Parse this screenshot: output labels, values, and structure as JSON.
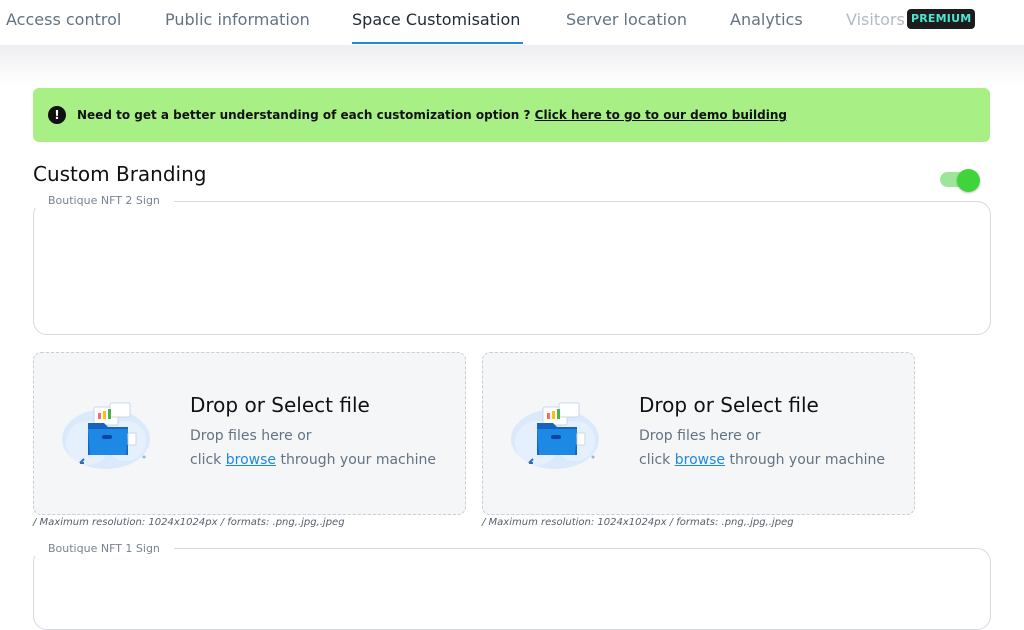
{
  "tabs": [
    {
      "label": "Access control"
    },
    {
      "label": "Public information"
    },
    {
      "label": "Space Customisation"
    },
    {
      "label": "Server location"
    },
    {
      "label": "Analytics"
    },
    {
      "label": "Visitors"
    }
  ],
  "badge": {
    "label": "PREMIUM"
  },
  "alert": {
    "text": "Need to get a better understanding of each customization option ?",
    "link": "Click here to go to our demo building"
  },
  "branding": {
    "title": "Custom Branding",
    "toggle_on": true,
    "sign2_label": "Boutique NFT 2 Sign",
    "sign1_label": "Boutique NFT 1 Sign"
  },
  "dropzones": [
    {
      "title": "Drop or Select file",
      "line1": "Drop files here or",
      "line2_pre": "click",
      "browse": "browse",
      "line2_post": "through your machine",
      "hint": "/ Maximum resolution: 1024x1024px / formats: .png,.jpg,.jpeg"
    },
    {
      "title": "Drop or Select file",
      "line1": "Drop files here or",
      "line2_pre": "click",
      "browse": "browse",
      "line2_post": "through your machine",
      "hint": "/ Maximum resolution: 1024x1024px / formats: .png,.jpg,.jpeg"
    }
  ],
  "colors": {
    "alert_bg": "#a8f086",
    "active_tab_underline": "#1e88e5",
    "toggle_on": "#3fd43c",
    "link": "#1e88e5"
  }
}
